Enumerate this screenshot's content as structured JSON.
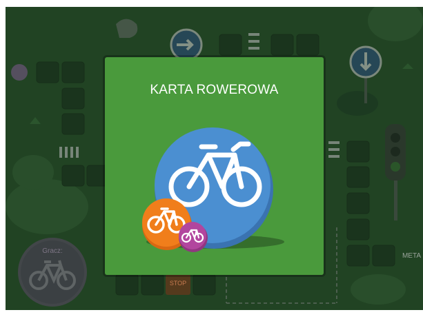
{
  "card": {
    "title": "KARTA ROWEROWA",
    "big_icon": "bicycle-icon",
    "small_icons": [
      "bicycle-icon",
      "bicycle-icon"
    ]
  },
  "board": {
    "player_label": "Gracz:",
    "stop_label": "STOP",
    "finish_label": "META",
    "signs": [
      "arrow-right-sign",
      "arrow-down-sign",
      "traffic-light"
    ]
  },
  "colors": {
    "card_green": "#4a9a3c",
    "big_circle": "#4b8fd1",
    "orange_circle": "#f07e1b",
    "purple_circle": "#b2469e",
    "board_dim": "#2c5a2f"
  }
}
